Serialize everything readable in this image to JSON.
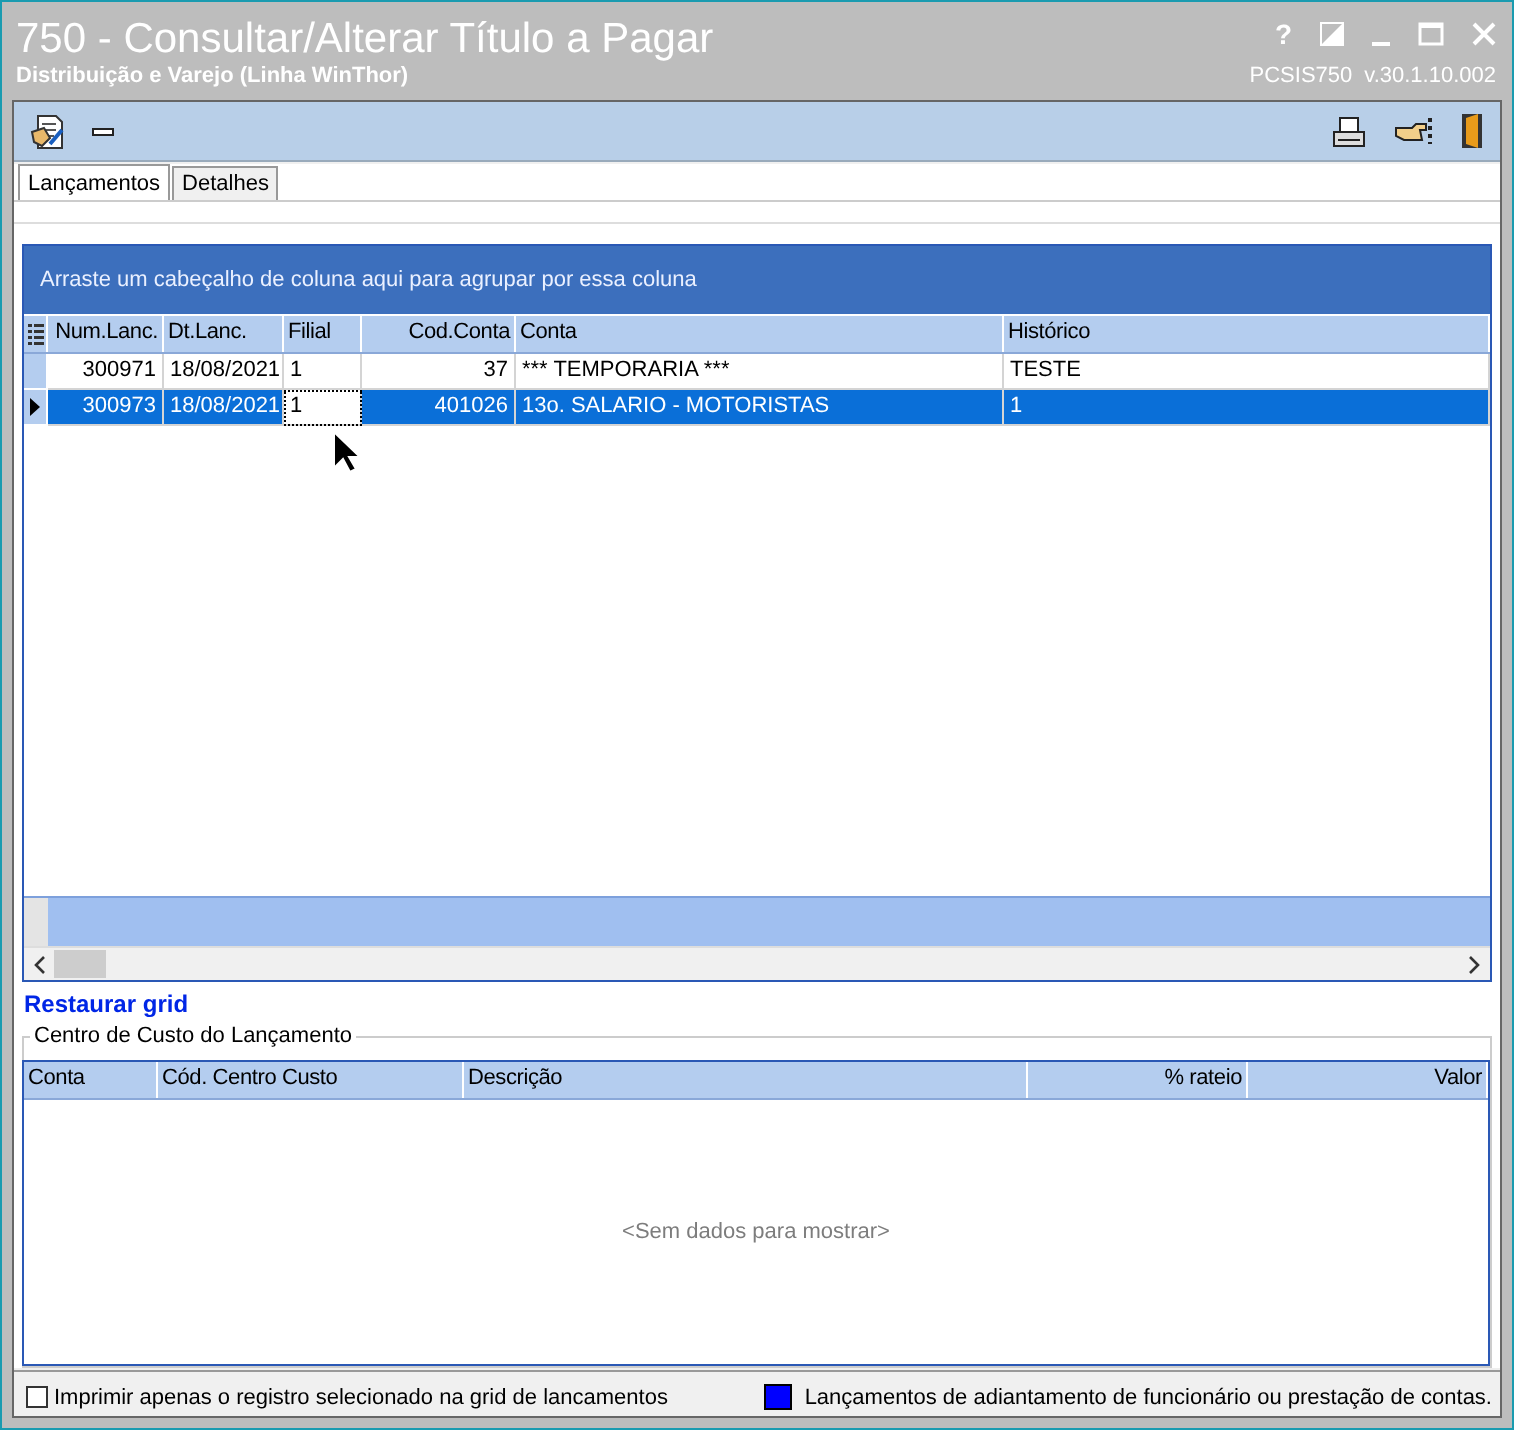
{
  "window": {
    "title": "750 - Consultar/Alterar Título a Pagar",
    "subtitle": "Distribuição e Varejo (Linha WinThor)",
    "program": "PCSIS750",
    "version": "v.30.1.10.002",
    "help": "?"
  },
  "tabs": [
    {
      "label": "Lançamentos",
      "selected": true
    },
    {
      "label": "Detalhes",
      "selected": false
    }
  ],
  "grid": {
    "group_hint": "Arraste um cabeçalho de coluna aqui para agrupar por essa coluna",
    "columns": [
      {
        "label": "Num.Lanc.",
        "focused": false
      },
      {
        "label": "Dt.Lanc.",
        "focused": false
      },
      {
        "label": "Filial",
        "focused": true
      },
      {
        "label": "Cod.Conta",
        "focused": false
      },
      {
        "label": "Conta",
        "focused": false
      },
      {
        "label": "Histórico",
        "focused": false
      }
    ],
    "rows": [
      {
        "selected": false,
        "cells": [
          "300971",
          "18/08/2021",
          "1",
          "37",
          "*** TEMPORARIA ***",
          "TESTE"
        ]
      },
      {
        "selected": true,
        "cells": [
          "300973",
          "18/08/2021",
          "1",
          "401026",
          "13o. SALARIO - MOTORISTAS",
          "1"
        ]
      }
    ]
  },
  "restore_link": "Restaurar grid",
  "cost_center": {
    "title": "Centro de Custo do Lançamento",
    "columns": [
      {
        "label": "Conta"
      },
      {
        "label": "Cód. Centro Custo"
      },
      {
        "label": "Descrição"
      },
      {
        "label": "% rateio"
      },
      {
        "label": "Valor"
      }
    ],
    "empty_text": "<Sem dados para mostrar>"
  },
  "footer": {
    "checkbox": {
      "label": "Imprimir apenas o registro selecionado na grid de lancamentos",
      "checked": false
    },
    "legend": {
      "label": "Lançamentos de adiantamento de funcionário ou prestação de contas.",
      "color": "#0000ff"
    }
  }
}
